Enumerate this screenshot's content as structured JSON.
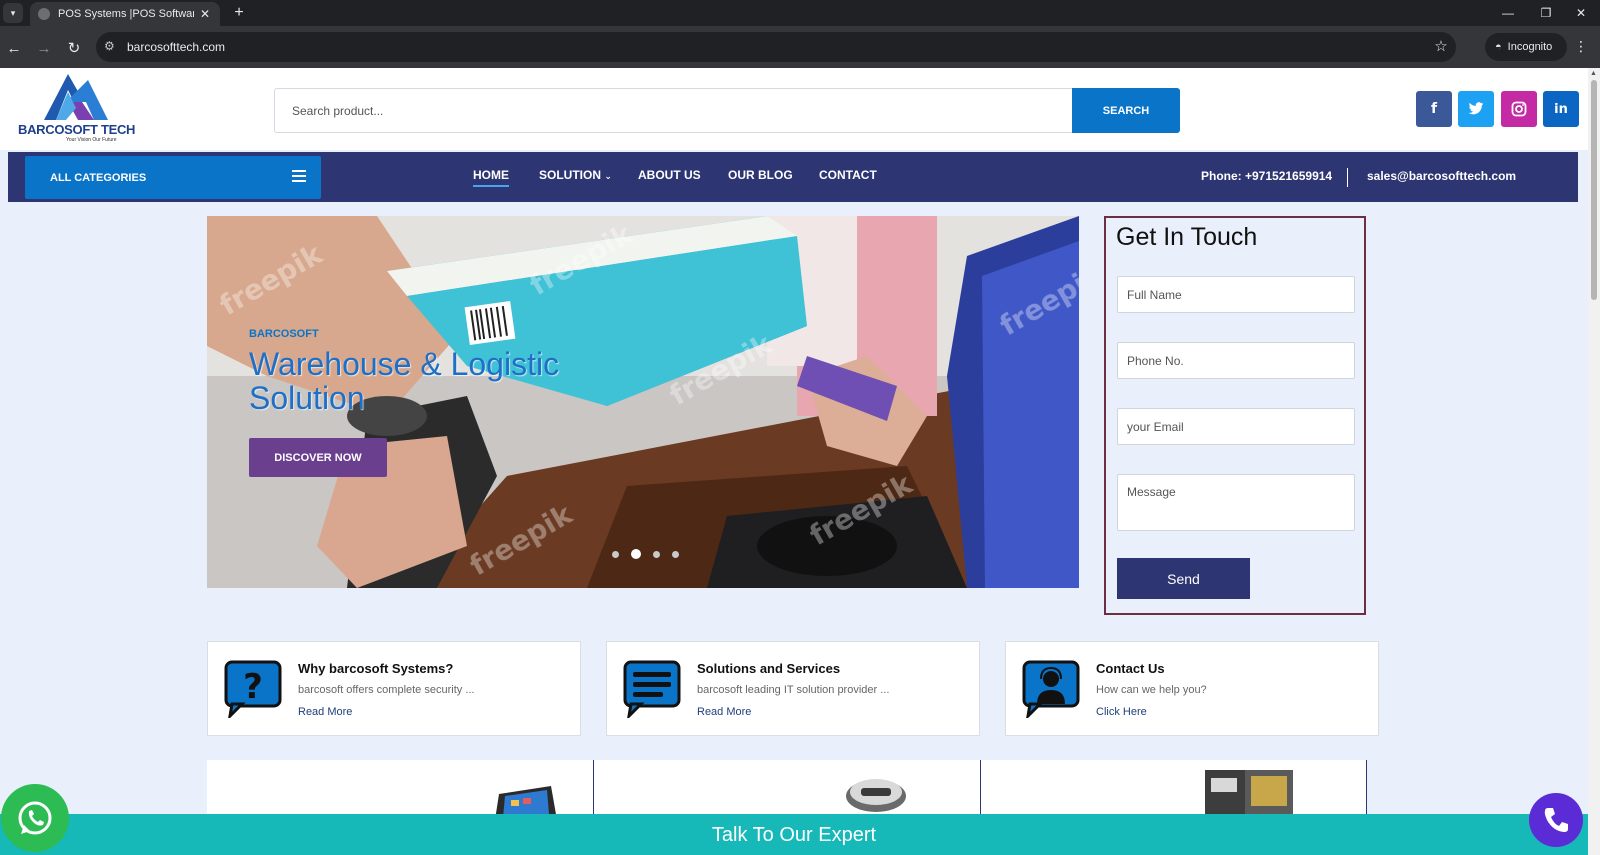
{
  "browser": {
    "tab_title": "POS Systems |POS Software & POS Hardware",
    "tab_close": "✕",
    "new_tab": "+",
    "url": "barcosofttech.com",
    "incognito_label": "Incognito"
  },
  "header": {
    "logo_name": "BARCOSOFT TECH",
    "logo_tagline": "Your Vision Our Future",
    "search_placeholder": "Search product...",
    "search_button": "SEARCH",
    "social": [
      {
        "name": "facebook",
        "glyph": "f",
        "color": "#3b5998"
      },
      {
        "name": "twitter",
        "glyph": "t",
        "color": "#1da1f2"
      },
      {
        "name": "instagram",
        "glyph": "◎",
        "color": "#c32aa3"
      },
      {
        "name": "linkedin",
        "glyph": "in",
        "color": "#0a66c2"
      }
    ]
  },
  "nav": {
    "all_categories": "ALL CATEGORIES",
    "items": [
      "HOME",
      "SOLUTION",
      "ABOUT US",
      "OUR BLOG",
      "CONTACT"
    ],
    "active": "HOME",
    "phone": "Phone: +971521659914",
    "email": "sales@barcosofttech.com"
  },
  "hero": {
    "eyebrow": "BARCOSOFT",
    "heading": "Warehouse & Logistic Solution",
    "cta": "DISCOVER NOW",
    "slide_count": 4,
    "active_slide": 2,
    "watermark": "freepik"
  },
  "contact_form": {
    "title": "Get In Touch",
    "full_name_placeholder": "Full Name",
    "phone_placeholder": "Phone No.",
    "email_placeholder": "your Email",
    "message_placeholder": "Message",
    "send": "Send"
  },
  "features": [
    {
      "title": "Why barcosoft Systems?",
      "desc": "barcosoft offers complete security ...",
      "link": "Read More",
      "icon": "question-bubble-icon"
    },
    {
      "title": "Solutions and Services",
      "desc": "barcosoft leading IT solution provider ...",
      "link": "Read More",
      "icon": "chat-bubble-icon"
    },
    {
      "title": "Contact Us",
      "desc": "How can we help you?",
      "link": "Click Here",
      "icon": "support-agent-icon"
    }
  ],
  "footer_bar": {
    "expert": "Talk To Our Expert"
  },
  "colors": {
    "nav_bg": "#2e3573",
    "accent_blue": "#0a74c9",
    "cta_purple": "#6a3f8e",
    "expert_teal": "#17b8b8",
    "form_border": "#6d2e44"
  }
}
